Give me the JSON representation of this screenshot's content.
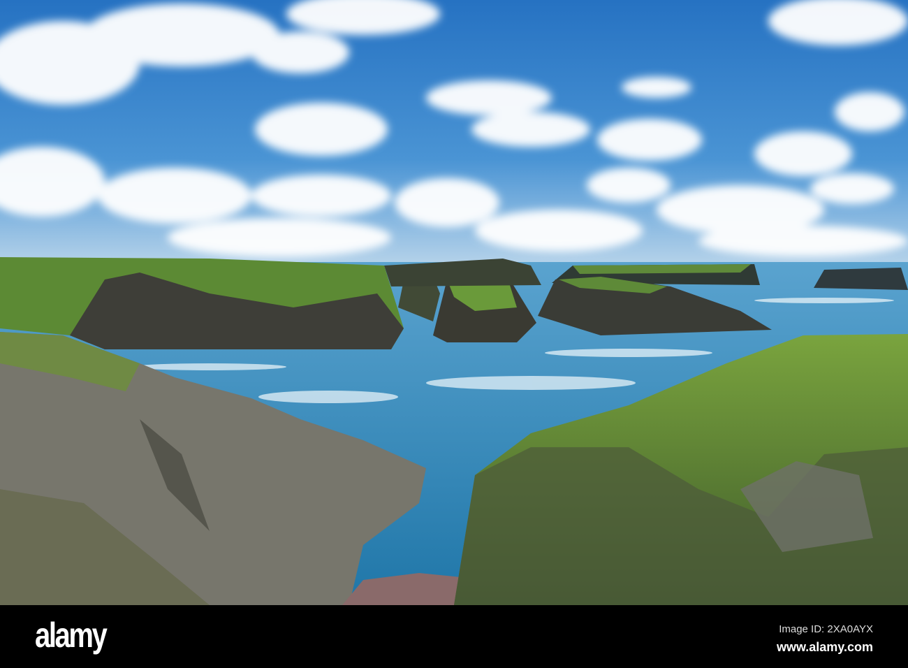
{
  "scene": {
    "subject": "coastal cliffs and rocky islets",
    "colors": {
      "sky_top": "#2a78c4",
      "sky_horizon": "#9fc7e4",
      "sea": "#2f86b8",
      "grass": "#6f9a3a",
      "rock": "#4a4a44"
    }
  },
  "watermark": {
    "logo": "alamy",
    "image_id": "Image ID: 2XA0AYX",
    "url": "www.alamy.com"
  }
}
